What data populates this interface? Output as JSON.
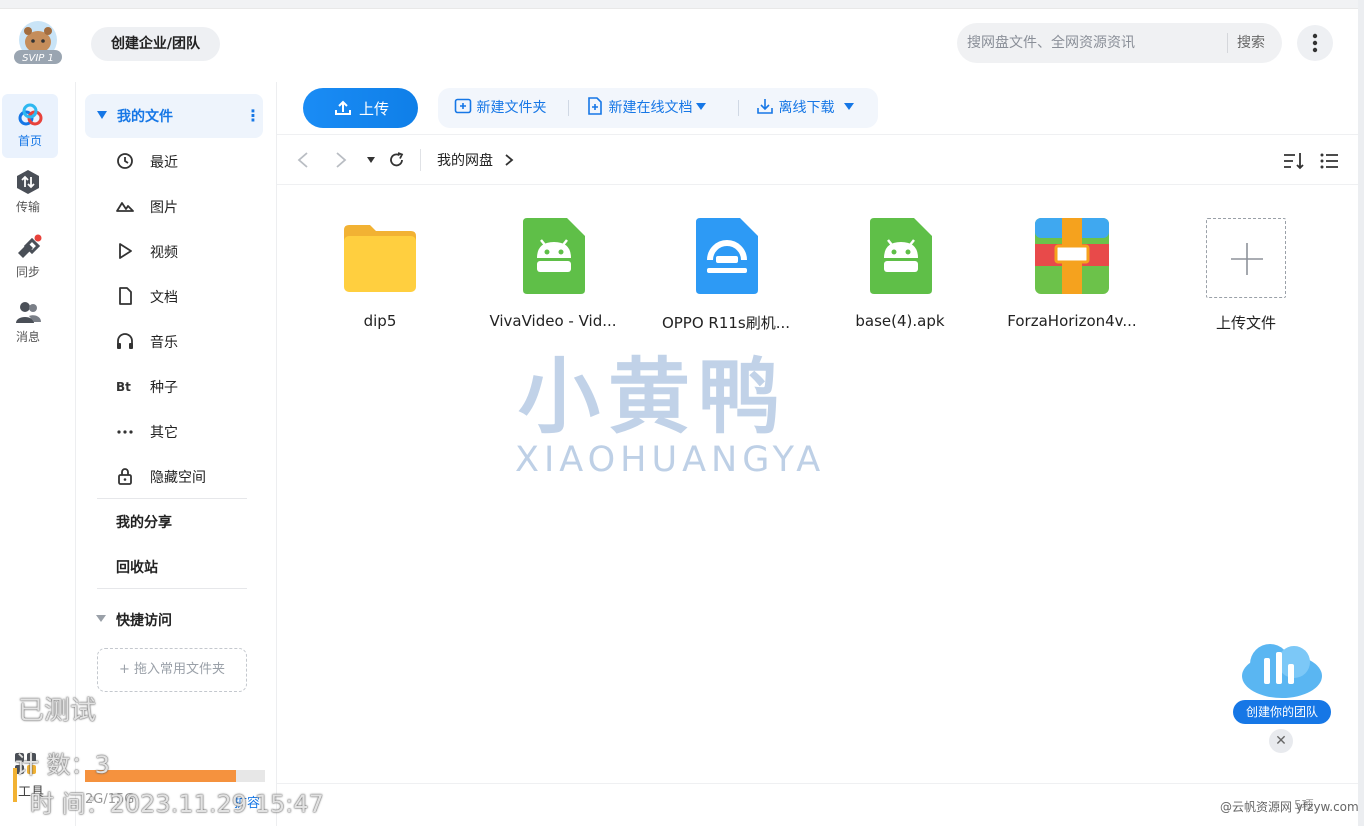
{
  "header": {
    "team_button": "创建企业/团队",
    "search_placeholder": "搜网盘文件、全网资源资讯",
    "search_button": "搜索"
  },
  "rail": [
    {
      "label": "首页",
      "icon": "home-icon",
      "active": true
    },
    {
      "label": "传输",
      "icon": "transfer-icon"
    },
    {
      "label": "同步",
      "icon": "sync-icon"
    },
    {
      "label": "消息",
      "icon": "message-icon"
    }
  ],
  "rail_tools_label": "工具",
  "sidebar": {
    "my_files": "我的文件",
    "items": [
      {
        "label": "最近",
        "icon": "clock-icon"
      },
      {
        "label": "图片",
        "icon": "image-icon"
      },
      {
        "label": "视频",
        "icon": "play-icon"
      },
      {
        "label": "文档",
        "icon": "document-icon"
      },
      {
        "label": "音乐",
        "icon": "headphones-icon"
      },
      {
        "label": "种子",
        "icon": "bt-icon"
      },
      {
        "label": "其它",
        "icon": "more-horizontal-icon"
      },
      {
        "label": "隐藏空间",
        "icon": "lock-icon"
      }
    ],
    "my_share": "我的分享",
    "recycle_bin": "回收站",
    "quick_access": "快捷访问",
    "drag_hint": "+ 拖入常用文件夹",
    "quota_text": "2G/15G",
    "quota_fraction": 0.84,
    "expand_link": "扩容"
  },
  "toolbar": {
    "upload": "上传",
    "new_folder": "新建文件夹",
    "new_online_doc": "新建在线文档",
    "offline_download": "离线下载"
  },
  "breadcrumb": {
    "path": "我的网盘"
  },
  "files": [
    {
      "name": "dip5",
      "type": "folder"
    },
    {
      "name": "VivaVideo - Vid...",
      "type": "apk"
    },
    {
      "name": "OPPO R11s刷机...",
      "type": "flash"
    },
    {
      "name": "base(4).apk",
      "type": "apk"
    },
    {
      "name": "ForzaHorizon4v...",
      "type": "archive"
    }
  ],
  "upload_tile_label": "上传文件",
  "watermark": {
    "cn": "小黄鸭",
    "en": "XIAOHUANGYA"
  },
  "overlay": {
    "tested": "已测试",
    "count": "计    数：3",
    "time": "时    间：2023.11.29 15:47"
  },
  "footer": {
    "item_count": "5项",
    "credit": "@云帆资源网 yfzyw.com"
  },
  "team_widget_label": "创建你的团队",
  "colors": {
    "accent": "#1677e6",
    "quota": "#f5923e"
  }
}
